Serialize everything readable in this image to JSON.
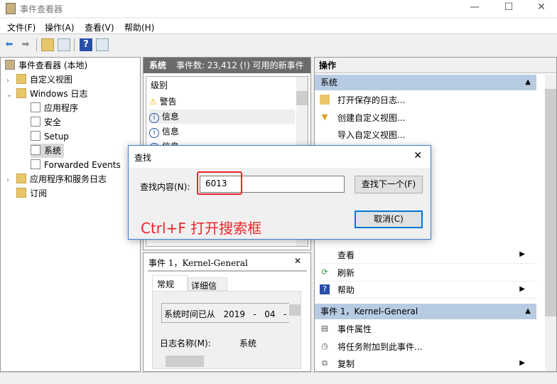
{
  "window": {
    "title": "事件查看器",
    "controls": [
      "—",
      "☐",
      "✕"
    ]
  },
  "menu": [
    "文件(F)",
    "操作(A)",
    "查看(V)",
    "帮助(H)"
  ],
  "toolbar": [
    "back-icon",
    "forward-icon",
    "up-folder-icon",
    "show-hide-tree-icon",
    "help-icon",
    "show-hide-action-icon"
  ],
  "tree": {
    "root": "事件查看器 (本地)",
    "items": [
      {
        "label": "自定义视图",
        "level": 1,
        "expander": ">"
      },
      {
        "label": "Windows 日志",
        "level": 1,
        "expander": "v"
      },
      {
        "label": "应用程序",
        "level": 2
      },
      {
        "label": "安全",
        "level": 2
      },
      {
        "label": "Setup",
        "level": 2
      },
      {
        "label": "系统",
        "level": 2,
        "selected": true
      },
      {
        "label": "Forwarded Events",
        "level": 2
      },
      {
        "label": "应用程序和服务日志",
        "level": 1,
        "expander": ">"
      },
      {
        "label": "订阅",
        "level": 1
      }
    ]
  },
  "middle": {
    "log_name": "系统",
    "event_count": "事件数: 23,412 (!) 可用的新事件",
    "column": "级别",
    "rows": [
      {
        "icon": "warning-icon",
        "label": "警告"
      },
      {
        "icon": "info-icon",
        "label": "信息"
      },
      {
        "icon": "info-icon",
        "label": "信息"
      },
      {
        "icon": "info-icon",
        "label": "信息"
      }
    ]
  },
  "detail": {
    "title": "事件 1，Kernel-General",
    "close": "✕",
    "tabs": [
      "常规",
      "详细信息"
    ],
    "description": "系统时间已从   2019   -   04   -",
    "log_label": "日志名称(M):",
    "log_value": "系统"
  },
  "actions": {
    "header": "操作",
    "section1": "系统",
    "items1": [
      {
        "label": "打开保存的日志...",
        "icon": "open-folder-icon"
      },
      {
        "label": "创建自定义视图...",
        "icon": "filter-icon"
      },
      {
        "label": "导入自定义视图...",
        "icon": ""
      }
    ],
    "items1b": [
      {
        "label": "查看",
        "icon": "",
        "submenu": true
      },
      {
        "label": "刷新",
        "icon": "refresh-icon"
      },
      {
        "label": "帮助",
        "icon": "help-icon",
        "submenu": true
      }
    ],
    "section2": "事件 1，Kernel-General",
    "items2": [
      {
        "label": "事件属性",
        "icon": "properties-icon"
      },
      {
        "label": "将任务附加到此事件...",
        "icon": "task-icon"
      },
      {
        "label": "复制",
        "icon": "copy-icon",
        "submenu": true
      }
    ]
  },
  "dialog": {
    "title": "查找",
    "label": "查找内容(N):",
    "value": "6013",
    "find_next": "查找下一个(F)",
    "cancel": "取消(C)",
    "close": "✕"
  },
  "annotation": {
    "text": "Ctrl+F 打开搜索框",
    "color": "#e8262b"
  },
  "colors": {
    "section": "#b7cbe3",
    "header": "#6b6b6b",
    "dialog_border": "#3c7fc8",
    "focus": "#0078d7"
  }
}
